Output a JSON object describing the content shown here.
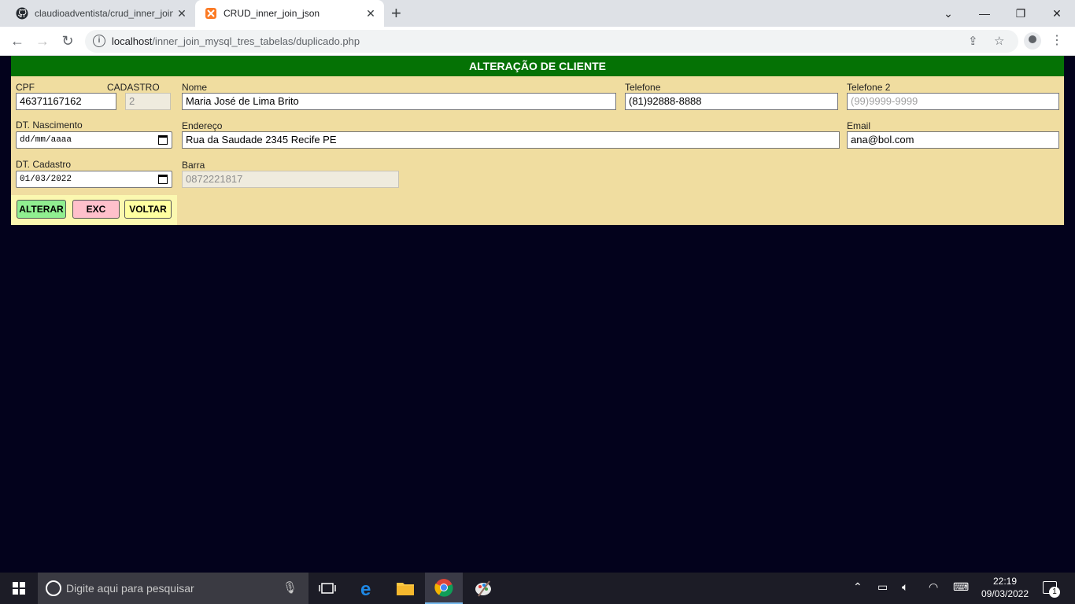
{
  "browser": {
    "tabs": [
      {
        "title": "claudioadventista/crud_inner_join_json",
        "icon": "github-icon"
      },
      {
        "title": "CRUD_inner_join_json",
        "icon": "xampp-icon"
      }
    ],
    "url_host": "localhost",
    "url_path": "/inner_join_mysql_tres_tabelas/duplicado.php"
  },
  "form": {
    "title": "ALTERAÇÃO DE CLIENTE",
    "fields": {
      "cpf": {
        "label": "CPF",
        "value": "46371167162"
      },
      "cadastro": {
        "label": "CADASTRO",
        "value": "2"
      },
      "nome": {
        "label": "Nome",
        "value": "Maria José de Lima Brito"
      },
      "telefone": {
        "label": "Telefone",
        "value": "(81)92888-8888"
      },
      "telefone2": {
        "label": "Telefone 2",
        "placeholder": "(99)9999-9999"
      },
      "dt_nascimento": {
        "label": "DT. Nascimento",
        "value": "dd/mm/aaaa"
      },
      "endereco": {
        "label": "Endereço",
        "value": "Rua da Saudade 2345 Recife PE"
      },
      "email": {
        "label": "Email",
        "value": "ana@bol.com"
      },
      "dt_cadastro": {
        "label": "DT. Cadastro",
        "value": "01/03/2022"
      },
      "barra": {
        "label": "Barra",
        "value": "0872221817"
      }
    },
    "buttons": {
      "alterar": "ALTERAR",
      "exc": "EXC",
      "voltar": "VOLTAR"
    },
    "colors": {
      "header_bg": "#057205",
      "form_bg": "#f0dda0",
      "alterar_bg": "#90ee90",
      "exc_bg": "#ffc0cb",
      "voltar_bg": "#ffffa0"
    }
  },
  "taskbar": {
    "search_placeholder": "Digite aqui para pesquisar",
    "time": "22:19",
    "date": "09/03/2022",
    "notification_count": "1"
  }
}
